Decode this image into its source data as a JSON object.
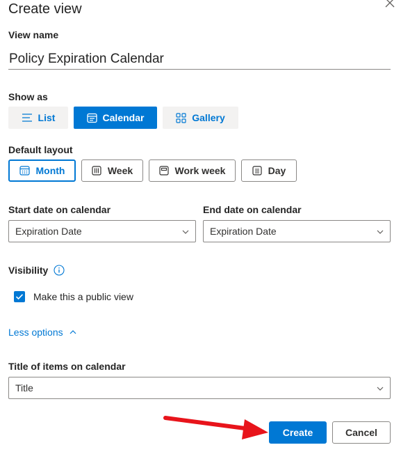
{
  "dialog": {
    "title": "Create view",
    "view_name_label": "View name",
    "view_name_value": "Policy Expiration Calendar",
    "show_as_label": "Show as",
    "show_as_options": [
      {
        "label": "List",
        "icon": "list-icon",
        "selected": false
      },
      {
        "label": "Calendar",
        "icon": "calendar-icon",
        "selected": true
      },
      {
        "label": "Gallery",
        "icon": "gallery-icon",
        "selected": false
      }
    ],
    "default_layout_label": "Default layout",
    "layout_options": [
      {
        "label": "Month",
        "icon": "month-icon",
        "selected": true
      },
      {
        "label": "Week",
        "icon": "week-icon",
        "selected": false
      },
      {
        "label": "Work week",
        "icon": "work-week-icon",
        "selected": false
      },
      {
        "label": "Day",
        "icon": "day-icon",
        "selected": false
      }
    ],
    "start_date_label": "Start date on calendar",
    "start_date_value": "Expiration Date",
    "end_date_label": "End date on calendar",
    "end_date_value": "Expiration Date",
    "visibility_label": "Visibility",
    "public_view_label": "Make this a public view",
    "public_view_checked": true,
    "less_options_label": "Less options",
    "title_items_label": "Title of items on calendar",
    "title_items_value": "Title",
    "create_label": "Create",
    "cancel_label": "Cancel"
  },
  "colors": {
    "accent": "#0078d4",
    "annotation_arrow": "#e8141b"
  }
}
